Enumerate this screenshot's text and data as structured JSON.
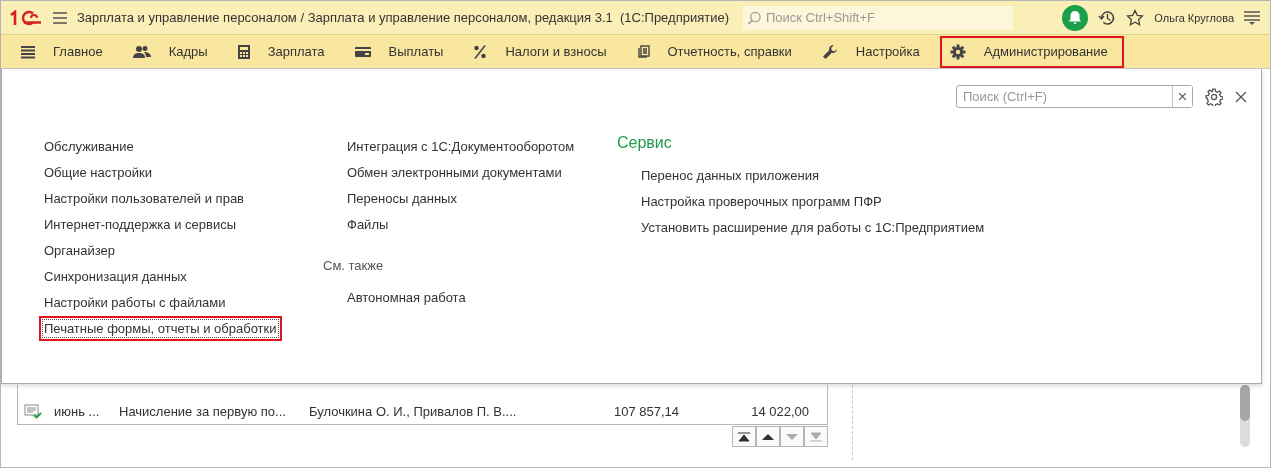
{
  "top_bar": {
    "title": "Зарплата и управление персоналом / Зарплата и управление персоналом, редакция 3.1  (1С:Предприятие)",
    "search": {
      "placeholder": "Поиск Ctrl+Shift+F"
    },
    "user": "Ольга Круглова"
  },
  "sections": [
    {
      "label": "Главное",
      "selected": false
    },
    {
      "label": "Кадры",
      "selected": false
    },
    {
      "label": "Зарплата",
      "selected": false
    },
    {
      "label": "Выплаты",
      "selected": false
    },
    {
      "label": "Налоги и взносы",
      "selected": false
    },
    {
      "label": "Отчетность, справки",
      "selected": false
    },
    {
      "label": "Настройка",
      "selected": false
    },
    {
      "label": "Администрирование",
      "selected": true
    }
  ],
  "panel": {
    "search": {
      "placeholder": "Поиск (Ctrl+F)"
    },
    "columns": [
      {
        "groups": [
          {
            "items": [
              {
                "label": "Обслуживание",
                "focused": false
              },
              {
                "label": "Общие настройки",
                "focused": false
              },
              {
                "label": "Настройки пользователей и прав",
                "focused": false
              },
              {
                "label": "Интернет-поддержка и сервисы",
                "focused": false
              },
              {
                "label": "Органайзер",
                "focused": false
              },
              {
                "label": "Синхронизация данных",
                "focused": false
              },
              {
                "label": "Настройки работы с файлами",
                "focused": false
              },
              {
                "label": "Печатные формы, отчеты и обработки",
                "focused": true
              }
            ]
          }
        ]
      },
      {
        "groups": [
          {
            "items": [
              {
                "label": "Интеграция с 1С:Документооборотом",
                "focused": false
              },
              {
                "label": "Обмен электронными документами",
                "focused": false
              },
              {
                "label": "Переносы данных",
                "focused": false
              },
              {
                "label": "Файлы",
                "focused": false
              }
            ]
          },
          {
            "heading": "См. также",
            "items": [
              {
                "label": "Автономная работа",
                "focused": false
              }
            ]
          }
        ]
      },
      {
        "groups": [
          {
            "heading": "Сервис",
            "items": [
              {
                "label": "Перенос данных приложения",
                "focused": false
              },
              {
                "label": "Настройка проверочных программ ПФР",
                "focused": false
              },
              {
                "label": "Установить расширение для работы с 1С:Предприятием",
                "focused": false
              }
            ]
          }
        ]
      }
    ]
  },
  "background": {
    "rows": [
      {
        "posted": true,
        "cells": [
          "июнь ...",
          "Начисление за первую по...",
          "Булочкина О. И., Привалов П. В....",
          "107 857,14",
          "14 022,00"
        ]
      }
    ]
  }
}
